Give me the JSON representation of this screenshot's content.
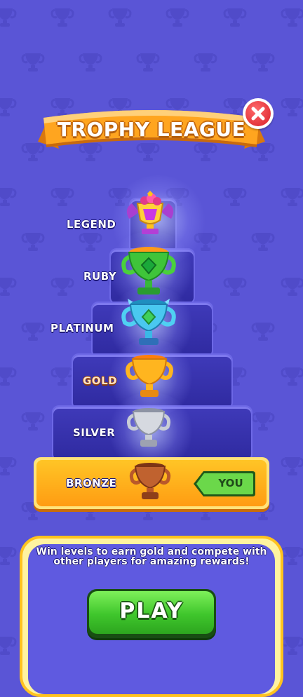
{
  "header": {
    "title": "TROPHY LEAGUE",
    "close_icon": "close-icon"
  },
  "tiers": [
    {
      "label": "LEGEND",
      "icon": "legend-trophy-icon",
      "color": "#b33fd6"
    },
    {
      "label": "RUBY",
      "icon": "ruby-trophy-icon",
      "color": "#38c23a"
    },
    {
      "label": "PLATINUM",
      "icon": "platinum-trophy-icon",
      "color": "#48c8f0"
    },
    {
      "label": "GOLD",
      "icon": "gold-trophy-icon",
      "color": "#ffb21a"
    },
    {
      "label": "SILVER",
      "icon": "silver-trophy-icon",
      "color": "#c9cdd6"
    },
    {
      "label": "BRONZE",
      "icon": "bronze-trophy-icon",
      "color": "#b9582a"
    }
  ],
  "current": {
    "badge": "YOU"
  },
  "footer": {
    "description": "Win levels to earn gold and compete with other players for amazing rewards!",
    "play_label": "PLAY"
  },
  "colors": {
    "background": "#5a55d6",
    "banner": "#ff9c1a",
    "highlight_row": "#ffb21a",
    "play_button": "#3fc62c",
    "close_button": "#e02b34"
  }
}
